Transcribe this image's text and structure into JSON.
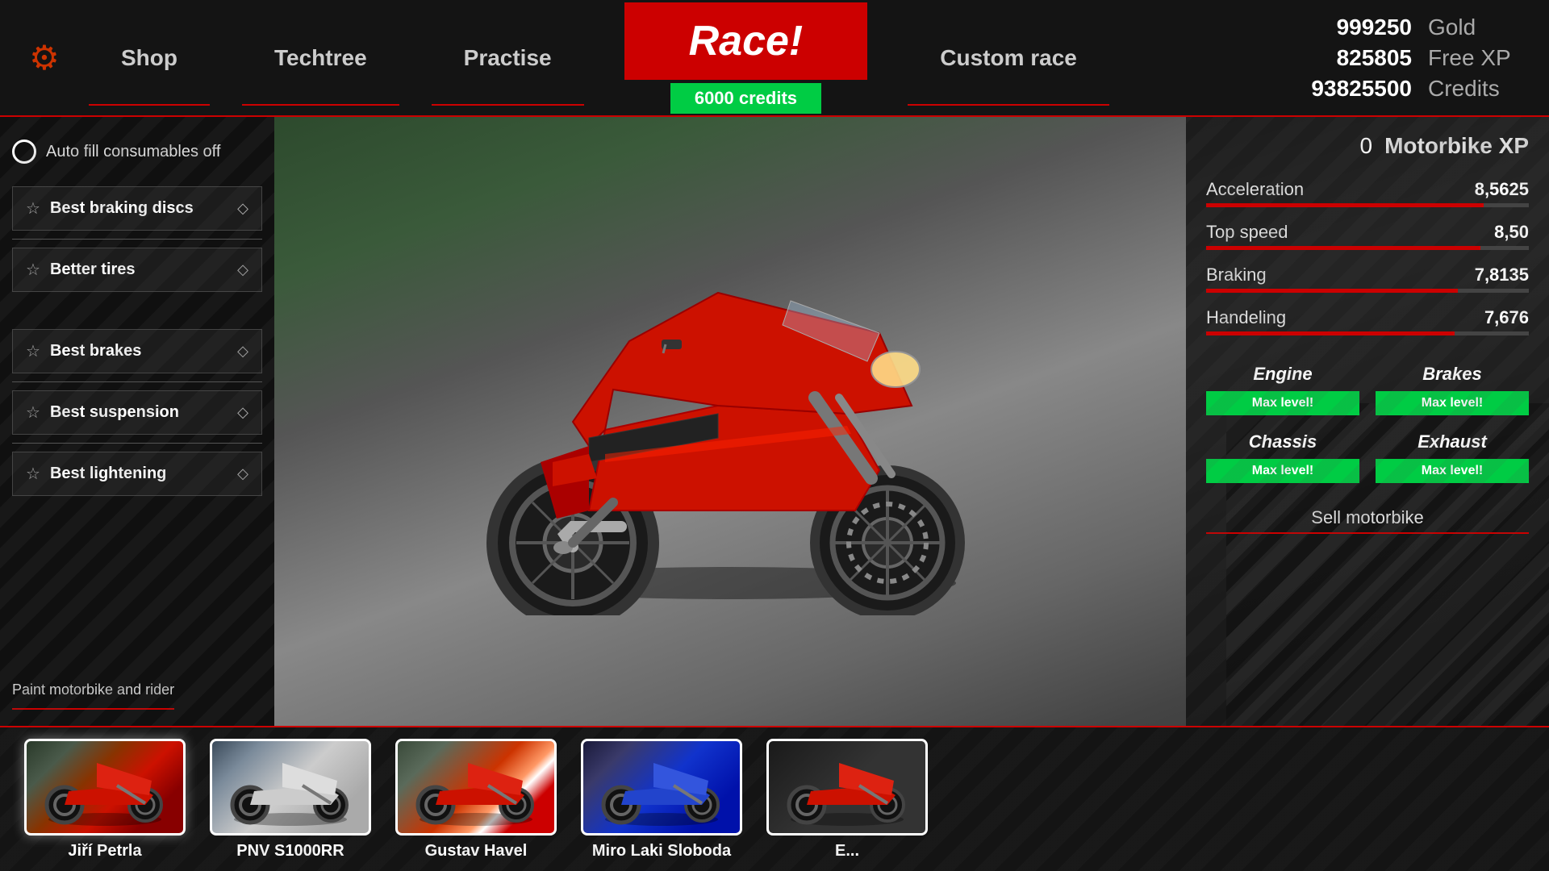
{
  "nav": {
    "shop_label": "Shop",
    "techtree_label": "Techtree",
    "practise_label": "Practise",
    "race_label": "Race!",
    "race_credits": "6000 credits",
    "custom_race_label": "Custom race"
  },
  "stats_header": {
    "gold_value": "999250",
    "gold_label": "Gold",
    "xp_value": "825805",
    "xp_label": "Free XP",
    "credits_value": "93825500",
    "credits_label": "Credits"
  },
  "sidebar": {
    "auto_fill_label": "Auto fill consumables off",
    "parts": [
      {
        "name": "Best braking discs"
      },
      {
        "name": "Better tires"
      },
      {
        "name": "Best brakes"
      },
      {
        "name": "Best suspension"
      },
      {
        "name": "Best lightening"
      }
    ],
    "paint_label": "Paint motorbike and rider"
  },
  "bike_stats": {
    "xp_value": "0",
    "xp_label": "Motorbike XP",
    "stats": [
      {
        "name": "Acceleration",
        "value": "8,5625",
        "pct": 86
      },
      {
        "name": "Top speed",
        "value": "8,50",
        "pct": 85
      },
      {
        "name": "Braking",
        "value": "7,8135",
        "pct": 78
      },
      {
        "name": "Handeling",
        "value": "7,676",
        "pct": 77
      }
    ],
    "upgrades": [
      {
        "name": "Engine",
        "badge": "Max level!"
      },
      {
        "name": "Brakes",
        "badge": "Max level!"
      },
      {
        "name": "Chassis",
        "badge": "Max level!"
      },
      {
        "name": "Exhaust",
        "badge": "Max level!"
      }
    ],
    "sell_label": "Sell motorbike"
  },
  "garage": {
    "bikes": [
      {
        "name": "Jiří Petrla",
        "color": "red"
      },
      {
        "name": "PNV S1000RR",
        "color": "white"
      },
      {
        "name": "Gustav Havel",
        "color": "red2"
      },
      {
        "name": "Miro Laki Sloboda",
        "color": "blue"
      },
      {
        "name": "E...",
        "color": "dark"
      }
    ]
  }
}
